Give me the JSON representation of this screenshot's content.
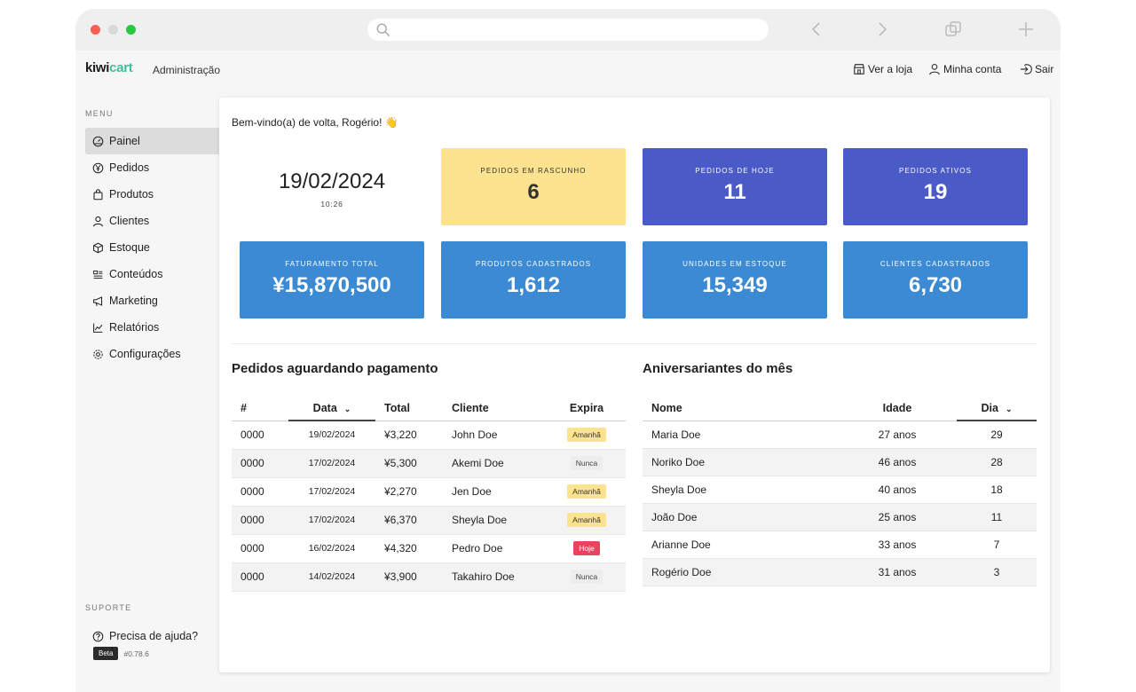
{
  "browser": {
    "url_placeholder": ""
  },
  "appbar": {
    "logo_part1": "kiwi",
    "logo_part2": "cart",
    "section": "Administração",
    "nav": [
      "Ver a loja",
      "Minha conta",
      "Sair"
    ]
  },
  "sidebar": {
    "menu_title": "MENU",
    "items": [
      {
        "label": "Painel",
        "icon": "dashboard-icon",
        "active": true
      },
      {
        "label": "Pedidos",
        "icon": "yen-icon"
      },
      {
        "label": "Produtos",
        "icon": "bag-icon"
      },
      {
        "label": "Clientes",
        "icon": "user-icon"
      },
      {
        "label": "Estoque",
        "icon": "box-icon"
      },
      {
        "label": "Conteúdos",
        "icon": "content-icon"
      },
      {
        "label": "Marketing",
        "icon": "megaphone-icon"
      },
      {
        "label": "Relatórios",
        "icon": "chart-icon"
      },
      {
        "label": "Configurações",
        "icon": "gear-icon"
      }
    ],
    "support_title": "SUPORTE",
    "help": "Precisa de ajuda?",
    "beta": "Beta",
    "version": "#0.78.6"
  },
  "main": {
    "welcome": "Bem-vindo(a) de volta, Rogério! 👋",
    "date": "19/02/2024",
    "time": "10:26",
    "stats": [
      {
        "label": "PEDIDOS EM RASCUNHO",
        "value": "6",
        "color": "#fde38f"
      },
      {
        "label": "PEDIDOS DE HOJE",
        "value": "11",
        "color": "#4a5bc7"
      },
      {
        "label": "PEDIDOS ATIVOS",
        "value": "19",
        "color": "#4a5bc7"
      },
      {
        "label": "FATURAMENTO TOTAL",
        "value": "¥15,870,500",
        "color": "#3b8ad3"
      },
      {
        "label": "PRODUTOS CADASTRADOS",
        "value": "1,612",
        "color": "#3b8ad3"
      },
      {
        "label": "UNIDADES EM ESTOQUE",
        "value": "15,349",
        "color": "#3b8ad3"
      },
      {
        "label": "CLIENTES CADASTRADOS",
        "value": "6,730",
        "color": "#3b8ad3"
      }
    ],
    "orders": {
      "title": "Pedidos aguardando pagamento",
      "columns": [
        "#",
        "Data",
        "Total",
        "Cliente",
        "Expira"
      ],
      "rows": [
        {
          "id": "0000",
          "date": "19/02/2024",
          "total": "¥3,220",
          "client": "John Doe",
          "expires": "Amanhã",
          "status": "amanha"
        },
        {
          "id": "0000",
          "date": "17/02/2024",
          "total": "¥5,300",
          "client": "Akemi Doe",
          "expires": "Nunca",
          "status": "nunca"
        },
        {
          "id": "0000",
          "date": "17/02/2024",
          "total": "¥2,270",
          "client": "Jen Doe",
          "expires": "Amanhã",
          "status": "amanha"
        },
        {
          "id": "0000",
          "date": "17/02/2024",
          "total": "¥6,370",
          "client": "Sheyla Doe",
          "expires": "Amanhã",
          "status": "amanha"
        },
        {
          "id": "0000",
          "date": "16/02/2024",
          "total": "¥4,320",
          "client": "Pedro Doe",
          "expires": "Hoje",
          "status": "hoje"
        },
        {
          "id": "0000",
          "date": "14/02/2024",
          "total": "¥3,900",
          "client": "Takahiro Doe",
          "expires": "Nunca",
          "status": "nunca"
        }
      ]
    },
    "birthdays": {
      "title": "Aniversariantes do mês",
      "columns": [
        "Nome",
        "Idade",
        "Dia"
      ],
      "rows": [
        {
          "name": "Maria Doe",
          "age": "27 anos",
          "day": "29"
        },
        {
          "name": "Noriko Doe",
          "age": "46 anos",
          "day": "28"
        },
        {
          "name": "Sheyla Doe",
          "age": "40 anos",
          "day": "18"
        },
        {
          "name": "João Doe",
          "age": "25 anos",
          "day": "11"
        },
        {
          "name": "Arianne Doe",
          "age": "33 anos",
          "day": "7"
        },
        {
          "name": "Rogério Doe",
          "age": "31 anos",
          "day": "3"
        }
      ]
    }
  }
}
